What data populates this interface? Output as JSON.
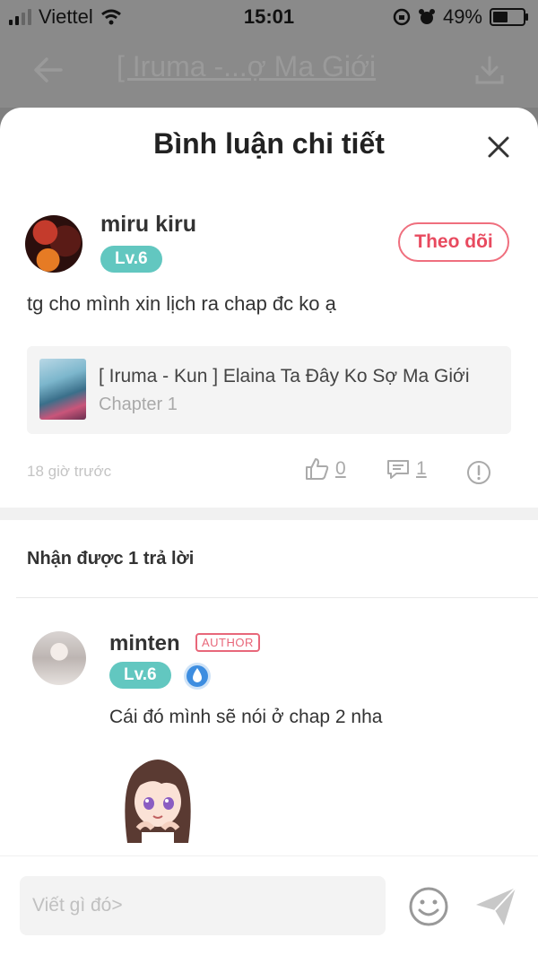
{
  "status_bar": {
    "carrier": "Viettel",
    "time": "15:01",
    "battery": "49%",
    "battery_level": 0.49
  },
  "background_header": {
    "title": "[ Iruma -...ợ Ma Giới"
  },
  "sheet": {
    "title": "Bình luận chi tiết"
  },
  "comment": {
    "username": "miru kiru",
    "level": "Lv.6",
    "follow_label": "Theo dõi",
    "text": "tg cho mình xin lịch ra chap đc ko ạ",
    "story": {
      "title": "[ Iruma - Kun ] Elaina Ta Đây Ko Sợ Ma Giới",
      "chapter": "Chapter 1"
    },
    "time": "18 giờ trước",
    "likes": "0",
    "replies": "1"
  },
  "replies_section": {
    "header": "Nhận được 1 trả lời"
  },
  "reply": {
    "username": "minten",
    "author_tag": "AUTHOR",
    "level": "Lv.6",
    "text": "Cái đó mình sẽ nói ở chap 2 nha"
  },
  "input": {
    "placeholder": "Viết gì đó>"
  },
  "colors": {
    "accent_red": "#e84a5f",
    "level_teal": "#62c7c0",
    "badge_blue": "#3d8de0"
  },
  "icons": [
    "wifi-icon",
    "alarm-icon",
    "back-arrow-icon",
    "download-icon",
    "close-icon",
    "like-icon",
    "reply-icon",
    "report-icon",
    "shield-badge-icon",
    "emoji-icon",
    "send-icon"
  ]
}
